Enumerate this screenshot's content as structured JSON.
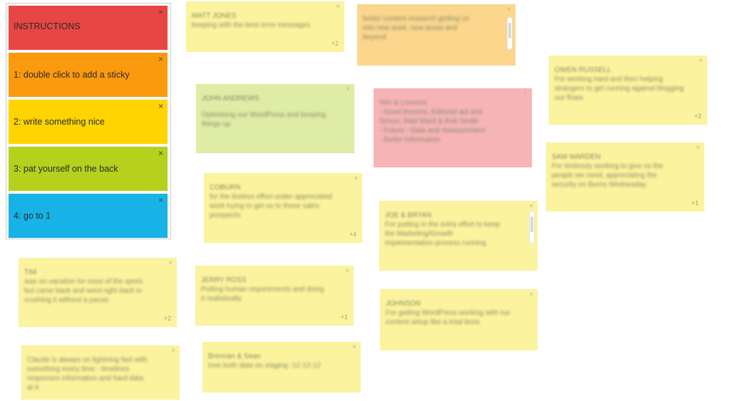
{
  "instructions": {
    "header": "INSTRUCTIONS",
    "close_glyph": "×",
    "steps": [
      "1: double click to add a sticky",
      "2: write something nice",
      "3: pat yourself on the back",
      "4: go to 1"
    ],
    "colors": [
      "#e84545",
      "#fb9a0c",
      "#ffd400",
      "#b5d11c",
      "#17b3e6"
    ]
  },
  "stickies": [
    {
      "author": "MATT JONES",
      "text": "keeping with the best error messages",
      "votes": "+2",
      "color": "yellow"
    },
    {
      "author": "",
      "text": "better content research getting us\ninto new work, new areas and\nbeyond",
      "votes": "",
      "color": "orange"
    },
    {
      "author": "OWEN RUSSELL",
      "text": "For working hard and then helping\nstrangers to get running against blogging\nour flows",
      "votes": "+2",
      "color": "yellow"
    },
    {
      "author": "JOHN ANDREWS",
      "text": "Optimising our WordPress and keeping\nthings up",
      "votes": "",
      "color": "green"
    },
    {
      "author": "",
      "text": "Win & Lessons\n- Good lessons, Editorial aid and\n  Simon, Matt Ward & Rob Smith\n- Future - Data and measurement\n- Better Information",
      "votes": "",
      "color": "red"
    },
    {
      "author": "SAM WARDEN",
      "text": "For tirelessly working to give us the\npeople we need, appreciating the\nsecurity on Burns Wednesday",
      "votes": "+1",
      "color": "yellow"
    },
    {
      "author": "COBURN",
      "text": "for the tireless effort under appreciated\nwork trying to get us to these sales\nprospects",
      "votes": "+4",
      "color": "yellow"
    },
    {
      "author": "JOE & BRYAN",
      "text": "For putting in the extra effort to keep\nthe Marketing/Growth\nimplementation process running",
      "votes": "",
      "color": "yellow"
    },
    {
      "author": "TIM",
      "text": "was on vacation for most of the sprint\nbut came back and went right back in\ncrushing it without a pause",
      "votes": "+2",
      "color": "yellow"
    },
    {
      "author": "JERRY ROSS",
      "text": "Putting human requirements and doing\nit realistically",
      "votes": "+1",
      "color": "yellow"
    },
    {
      "author": "JOHNSON",
      "text": "For getting WordPress working with our\ncontent setup like a total boss",
      "votes": "",
      "color": "yellow"
    },
    {
      "author": "",
      "text": "Claude is always on lightning fast with\nsomething every time - timelines\nresponses information and hard data\nat it",
      "votes": "",
      "color": "yellow"
    },
    {
      "author": "Brennan & Sean",
      "text": "love both data on staging -12-12-12",
      "votes": "",
      "color": "yellow"
    }
  ]
}
